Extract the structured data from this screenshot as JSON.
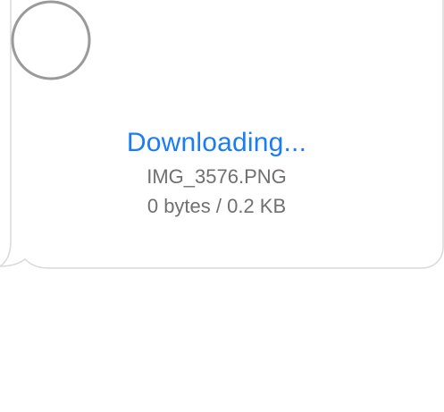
{
  "download": {
    "status": "Downloading...",
    "file_name": "IMG_3576.PNG",
    "progress_text": "0 bytes / 0.2 KB",
    "progress_fraction": 0
  },
  "colors": {
    "accent": "#1a7df5",
    "secondary_text": "#707070",
    "spinner_ring": "#9a9a9a",
    "bubble_border": "#d9d9d9"
  },
  "icons": {
    "spinner": "progress-ring-icon"
  }
}
